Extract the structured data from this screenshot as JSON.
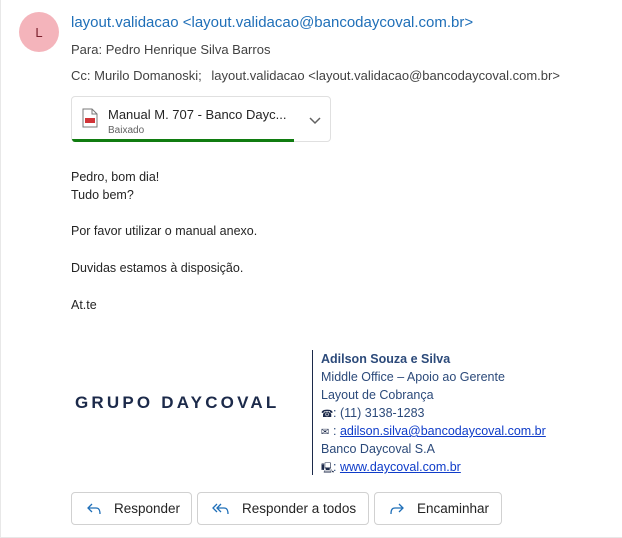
{
  "sender": {
    "avatar_initial": "L",
    "display": "layout.validacao <layout.validacao@bancodaycoval.com.br>"
  },
  "recipients": {
    "to_label": "Para:",
    "to_value": "Pedro Henrique Silva Barros",
    "cc_label": "Cc:",
    "cc_values": [
      "Murilo Domanoski;",
      "layout.validacao <layout.validacao@bancodaycoval.com.br>"
    ]
  },
  "attachment": {
    "name": "Manual M. 707 - Banco Dayc...",
    "status": "Baixado",
    "icon": "pdf-file-icon",
    "download_progress": 0.86
  },
  "message": {
    "lines": [
      "Pedro, bom dia!",
      "Tudo bem?",
      "Por favor utilizar o manual anexo.",
      "Duvidas estamos à disposição.",
      "At.te"
    ]
  },
  "signature": {
    "logo_text": "GRUPO DAYCOVAL",
    "name": "Adilson Souza e Silva",
    "role": "Middle Office – Apoio ao Gerente",
    "area": "Layout de Cobrança",
    "phone_icon": "☎",
    "phone": ": (11) 3138-1283",
    "email_icon": "✉",
    "email_prefix": ": ",
    "email": "adilson.silva@bancodaycoval.com.br",
    "company": "Banco Daycoval S.A",
    "web_icon": "🖳",
    "web_prefix": ": ",
    "website": "www.daycoval.com.br"
  },
  "actions": {
    "reply": "Responder",
    "reply_all": "Responder a todos",
    "forward": "Encaminhar"
  },
  "colors": {
    "accent": "#1f6fb8",
    "avatar_bg": "#f4b4bb",
    "progress": "#107c10",
    "signature_text": "#2c4a7a",
    "link": "#0f3cc9"
  }
}
